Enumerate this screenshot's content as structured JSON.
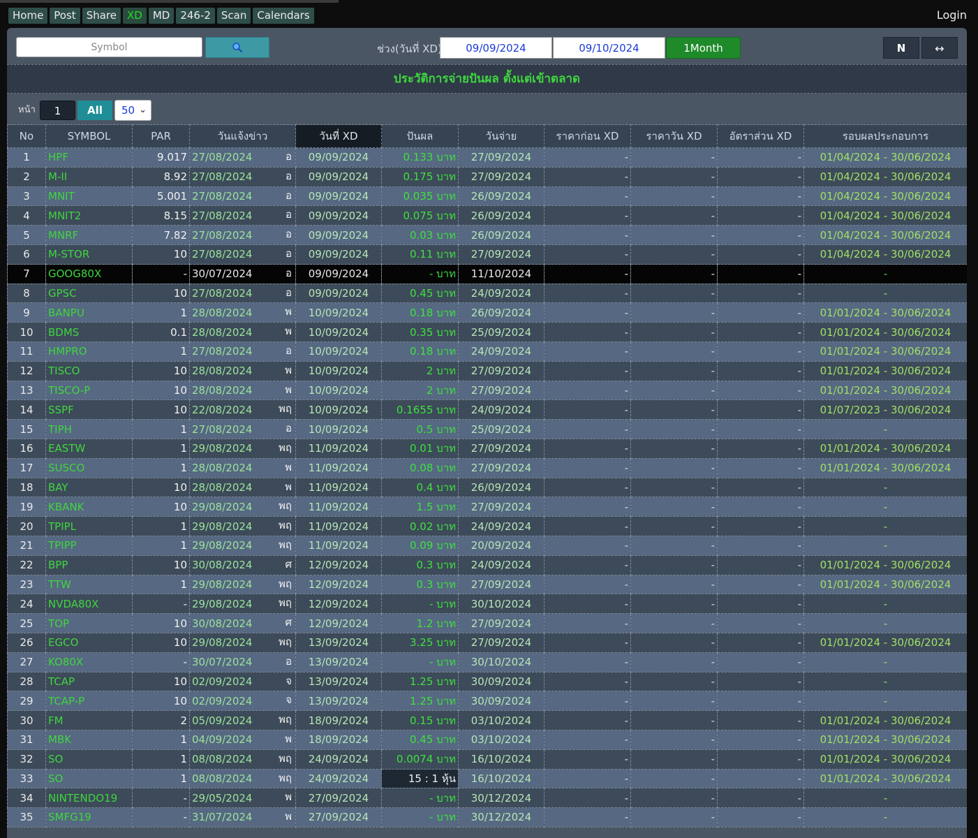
{
  "nav": {
    "items": [
      {
        "label": "Home"
      },
      {
        "label": "Post"
      },
      {
        "label": "Share"
      },
      {
        "label": "XD"
      },
      {
        "label": "MD"
      },
      {
        "label": "246-2"
      },
      {
        "label": "Scan"
      },
      {
        "label": "Calendars"
      }
    ],
    "active_index": 3,
    "login_label": "Login"
  },
  "toolbar": {
    "search_placeholder": "Symbol",
    "search_icon": "search-icon",
    "range_label": "ช่วง(วันที่ XD)",
    "date_from": "09/09/2024",
    "date_to": "09/10/2024",
    "month_button": "1Month",
    "n_button": "N",
    "expand_button": "↔"
  },
  "title": "ประวัติการจ่ายปันผล ตั้งแต่เข้าตลาด",
  "pager": {
    "label": "หน้า",
    "page": "1",
    "all_label": "All",
    "page_size": "50"
  },
  "colors": {
    "accent_green": "#3fd63f",
    "panel": "#4b5665",
    "row_odd": "#566882",
    "row_even": "#3d4a59"
  },
  "table": {
    "headers": [
      "No",
      "SYMBOL",
      "PAR",
      "วันแจ้งข่าว",
      "วันที่ XD",
      "ปันผล",
      "วันจ่าย",
      "ราคาก่อน XD",
      "ราคาวัน XD",
      "อัตราส่วน XD",
      "รอบผลประกอบการ"
    ],
    "rows": [
      {
        "no": "1",
        "symbol": "HPF",
        "par": "9.017",
        "announce": "27/08/2024",
        "day": "อ",
        "xd": "09/09/2024",
        "dividend": "0.133 บาท",
        "pay": "27/09/2024",
        "before": "-",
        "on": "-",
        "ratio": "-",
        "period": "01/04/2024 - 30/06/2024"
      },
      {
        "no": "2",
        "symbol": "M-II",
        "par": "8.92",
        "announce": "27/08/2024",
        "day": "อ",
        "xd": "09/09/2024",
        "dividend": "0.175 บาท",
        "pay": "27/09/2024",
        "before": "-",
        "on": "-",
        "ratio": "-",
        "period": "01/04/2024 - 30/06/2024"
      },
      {
        "no": "3",
        "symbol": "MNIT",
        "par": "5.001",
        "announce": "27/08/2024",
        "day": "อ",
        "xd": "09/09/2024",
        "dividend": "0.035 บาท",
        "pay": "26/09/2024",
        "before": "-",
        "on": "-",
        "ratio": "-",
        "period": "01/04/2024 - 30/06/2024"
      },
      {
        "no": "4",
        "symbol": "MNIT2",
        "par": "8.15",
        "announce": "27/08/2024",
        "day": "อ",
        "xd": "09/09/2024",
        "dividend": "0.075 บาท",
        "pay": "26/09/2024",
        "before": "-",
        "on": "-",
        "ratio": "-",
        "period": "01/04/2024 - 30/06/2024"
      },
      {
        "no": "5",
        "symbol": "MNRF",
        "par": "7.82",
        "announce": "27/08/2024",
        "day": "อ",
        "xd": "09/09/2024",
        "dividend": "0.03 บาท",
        "pay": "26/09/2024",
        "before": "-",
        "on": "-",
        "ratio": "-",
        "period": "01/04/2024 - 30/06/2024"
      },
      {
        "no": "6",
        "symbol": "M-STOR",
        "par": "10",
        "announce": "27/08/2024",
        "day": "อ",
        "xd": "09/09/2024",
        "dividend": "0.11 บาท",
        "pay": "27/09/2024",
        "before": "-",
        "on": "-",
        "ratio": "-",
        "period": "01/04/2024 - 30/06/2024"
      },
      {
        "no": "7",
        "symbol": "GOOG80X",
        "par": "-",
        "announce": "30/07/2024",
        "day": "อ",
        "xd": "09/09/2024",
        "dividend": "- บาท",
        "pay": "11/10/2024",
        "before": "-",
        "on": "-",
        "ratio": "-",
        "period": "-",
        "highlight": true
      },
      {
        "no": "8",
        "symbol": "GPSC",
        "par": "10",
        "announce": "27/08/2024",
        "day": "อ",
        "xd": "09/09/2024",
        "dividend": "0.45 บาท",
        "pay": "24/09/2024",
        "before": "-",
        "on": "-",
        "ratio": "-",
        "period": "-"
      },
      {
        "no": "9",
        "symbol": "BANPU",
        "par": "1",
        "announce": "28/08/2024",
        "day": "พ",
        "xd": "10/09/2024",
        "dividend": "0.18 บาท",
        "pay": "26/09/2024",
        "before": "-",
        "on": "-",
        "ratio": "-",
        "period": "01/01/2024 - 30/06/2024"
      },
      {
        "no": "10",
        "symbol": "BDMS",
        "par": "0.1",
        "announce": "28/08/2024",
        "day": "พ",
        "xd": "10/09/2024",
        "dividend": "0.35 บาท",
        "pay": "25/09/2024",
        "before": "-",
        "on": "-",
        "ratio": "-",
        "period": "01/01/2024 - 30/06/2024"
      },
      {
        "no": "11",
        "symbol": "HMPRO",
        "par": "1",
        "announce": "27/08/2024",
        "day": "อ",
        "xd": "10/09/2024",
        "dividend": "0.18 บาท",
        "pay": "24/09/2024",
        "before": "-",
        "on": "-",
        "ratio": "-",
        "period": "01/01/2024 - 30/06/2024"
      },
      {
        "no": "12",
        "symbol": "TISCO",
        "par": "10",
        "announce": "28/08/2024",
        "day": "พ",
        "xd": "10/09/2024",
        "dividend": "2 บาท",
        "pay": "27/09/2024",
        "before": "-",
        "on": "-",
        "ratio": "-",
        "period": "01/01/2024 - 30/06/2024"
      },
      {
        "no": "13",
        "symbol": "TISCO-P",
        "par": "10",
        "announce": "28/08/2024",
        "day": "พ",
        "xd": "10/09/2024",
        "dividend": "2 บาท",
        "pay": "27/09/2024",
        "before": "-",
        "on": "-",
        "ratio": "-",
        "period": "01/01/2024 - 30/06/2024"
      },
      {
        "no": "14",
        "symbol": "SSPF",
        "par": "10",
        "announce": "22/08/2024",
        "day": "พฤ",
        "xd": "10/09/2024",
        "dividend": "0.1655 บาท",
        "pay": "24/09/2024",
        "before": "-",
        "on": "-",
        "ratio": "-",
        "period": "01/07/2023 - 30/06/2024"
      },
      {
        "no": "15",
        "symbol": "TIPH",
        "par": "1",
        "announce": "27/08/2024",
        "day": "อ",
        "xd": "10/09/2024",
        "dividend": "0.5 บาท",
        "pay": "25/09/2024",
        "before": "-",
        "on": "-",
        "ratio": "-",
        "period": "-"
      },
      {
        "no": "16",
        "symbol": "EASTW",
        "par": "1",
        "announce": "29/08/2024",
        "day": "พฤ",
        "xd": "11/09/2024",
        "dividend": "0.01 บาท",
        "pay": "27/09/2024",
        "before": "-",
        "on": "-",
        "ratio": "-",
        "period": "01/01/2024 - 30/06/2024"
      },
      {
        "no": "17",
        "symbol": "SUSCO",
        "par": "1",
        "announce": "28/08/2024",
        "day": "พ",
        "xd": "11/09/2024",
        "dividend": "0.08 บาท",
        "pay": "27/09/2024",
        "before": "-",
        "on": "-",
        "ratio": "-",
        "period": "01/01/2024 - 30/06/2024"
      },
      {
        "no": "18",
        "symbol": "BAY",
        "par": "10",
        "announce": "28/08/2024",
        "day": "พ",
        "xd": "11/09/2024",
        "dividend": "0.4 บาท",
        "pay": "26/09/2024",
        "before": "-",
        "on": "-",
        "ratio": "-",
        "period": "-"
      },
      {
        "no": "19",
        "symbol": "KBANK",
        "par": "10",
        "announce": "29/08/2024",
        "day": "พฤ",
        "xd": "11/09/2024",
        "dividend": "1.5 บาท",
        "pay": "27/09/2024",
        "before": "-",
        "on": "-",
        "ratio": "-",
        "period": "-"
      },
      {
        "no": "20",
        "symbol": "TPIPL",
        "par": "1",
        "announce": "29/08/2024",
        "day": "พฤ",
        "xd": "11/09/2024",
        "dividend": "0.02 บาท",
        "pay": "24/09/2024",
        "before": "-",
        "on": "-",
        "ratio": "-",
        "period": "-"
      },
      {
        "no": "21",
        "symbol": "TPIPP",
        "par": "1",
        "announce": "29/08/2024",
        "day": "พฤ",
        "xd": "11/09/2024",
        "dividend": "0.09 บาท",
        "pay": "20/09/2024",
        "before": "-",
        "on": "-",
        "ratio": "-",
        "period": "-"
      },
      {
        "no": "22",
        "symbol": "BPP",
        "par": "10",
        "announce": "30/08/2024",
        "day": "ศ",
        "xd": "12/09/2024",
        "dividend": "0.3 บาท",
        "pay": "24/09/2024",
        "before": "-",
        "on": "-",
        "ratio": "-",
        "period": "01/01/2024 - 30/06/2024"
      },
      {
        "no": "23",
        "symbol": "TTW",
        "par": "1",
        "announce": "29/08/2024",
        "day": "พฤ",
        "xd": "12/09/2024",
        "dividend": "0.3 บาท",
        "pay": "27/09/2024",
        "before": "-",
        "on": "-",
        "ratio": "-",
        "period": "01/01/2024 - 30/06/2024"
      },
      {
        "no": "24",
        "symbol": "NVDA80X",
        "par": "-",
        "announce": "29/08/2024",
        "day": "พฤ",
        "xd": "12/09/2024",
        "dividend": "- บาท",
        "pay": "30/10/2024",
        "before": "-",
        "on": "-",
        "ratio": "-",
        "period": "-"
      },
      {
        "no": "25",
        "symbol": "TOP",
        "par": "10",
        "announce": "30/08/2024",
        "day": "ศ",
        "xd": "12/09/2024",
        "dividend": "1.2 บาท",
        "pay": "27/09/2024",
        "before": "-",
        "on": "-",
        "ratio": "-",
        "period": "-"
      },
      {
        "no": "26",
        "symbol": "EGCO",
        "par": "10",
        "announce": "29/08/2024",
        "day": "พฤ",
        "xd": "13/09/2024",
        "dividend": "3.25 บาท",
        "pay": "27/09/2024",
        "before": "-",
        "on": "-",
        "ratio": "-",
        "period": "01/01/2024 - 30/06/2024"
      },
      {
        "no": "27",
        "symbol": "KO80X",
        "par": "-",
        "announce": "30/07/2024",
        "day": "อ",
        "xd": "13/09/2024",
        "dividend": "- บาท",
        "pay": "30/10/2024",
        "before": "-",
        "on": "-",
        "ratio": "-",
        "period": "-"
      },
      {
        "no": "28",
        "symbol": "TCAP",
        "par": "10",
        "announce": "02/09/2024",
        "day": "จ",
        "xd": "13/09/2024",
        "dividend": "1.25 บาท",
        "pay": "30/09/2024",
        "before": "-",
        "on": "-",
        "ratio": "-",
        "period": "-"
      },
      {
        "no": "29",
        "symbol": "TCAP-P",
        "par": "10",
        "announce": "02/09/2024",
        "day": "จ",
        "xd": "13/09/2024",
        "dividend": "1.25 บาท",
        "pay": "30/09/2024",
        "before": "-",
        "on": "-",
        "ratio": "-",
        "period": "-"
      },
      {
        "no": "30",
        "symbol": "FM",
        "par": "2",
        "announce": "05/09/2024",
        "day": "พฤ",
        "xd": "18/09/2024",
        "dividend": "0.15 บาท",
        "pay": "03/10/2024",
        "before": "-",
        "on": "-",
        "ratio": "-",
        "period": "01/01/2024 - 30/06/2024"
      },
      {
        "no": "31",
        "symbol": "MBK",
        "par": "1",
        "announce": "04/09/2024",
        "day": "พ",
        "xd": "18/09/2024",
        "dividend": "0.45 บาท",
        "pay": "03/10/2024",
        "before": "-",
        "on": "-",
        "ratio": "-",
        "period": "01/01/2024 - 30/06/2024"
      },
      {
        "no": "32",
        "symbol": "SO",
        "par": "1",
        "announce": "08/08/2024",
        "day": "พฤ",
        "xd": "24/09/2024",
        "dividend": "0.0074 บาท",
        "pay": "16/10/2024",
        "before": "-",
        "on": "-",
        "ratio": "-",
        "period": "01/01/2024 - 30/06/2024"
      },
      {
        "no": "33",
        "symbol": "SO",
        "par": "1",
        "announce": "08/08/2024",
        "day": "พฤ",
        "xd": "24/09/2024",
        "dividend": "15 : 1 หุ้น",
        "pay": "16/10/2024",
        "before": "-",
        "on": "-",
        "ratio": "-",
        "period": "01/01/2024 - 30/06/2024",
        "stock": true
      },
      {
        "no": "34",
        "symbol": "NINTENDO19",
        "par": "-",
        "announce": "29/05/2024",
        "day": "พ",
        "xd": "27/09/2024",
        "dividend": "- บาท",
        "pay": "30/12/2024",
        "before": "-",
        "on": "-",
        "ratio": "-",
        "period": "-"
      },
      {
        "no": "35",
        "symbol": "SMFG19",
        "par": "-",
        "announce": "31/07/2024",
        "day": "พ",
        "xd": "27/09/2024",
        "dividend": "- บาท",
        "pay": "30/12/2024",
        "before": "-",
        "on": "-",
        "ratio": "-",
        "period": "-"
      }
    ]
  }
}
